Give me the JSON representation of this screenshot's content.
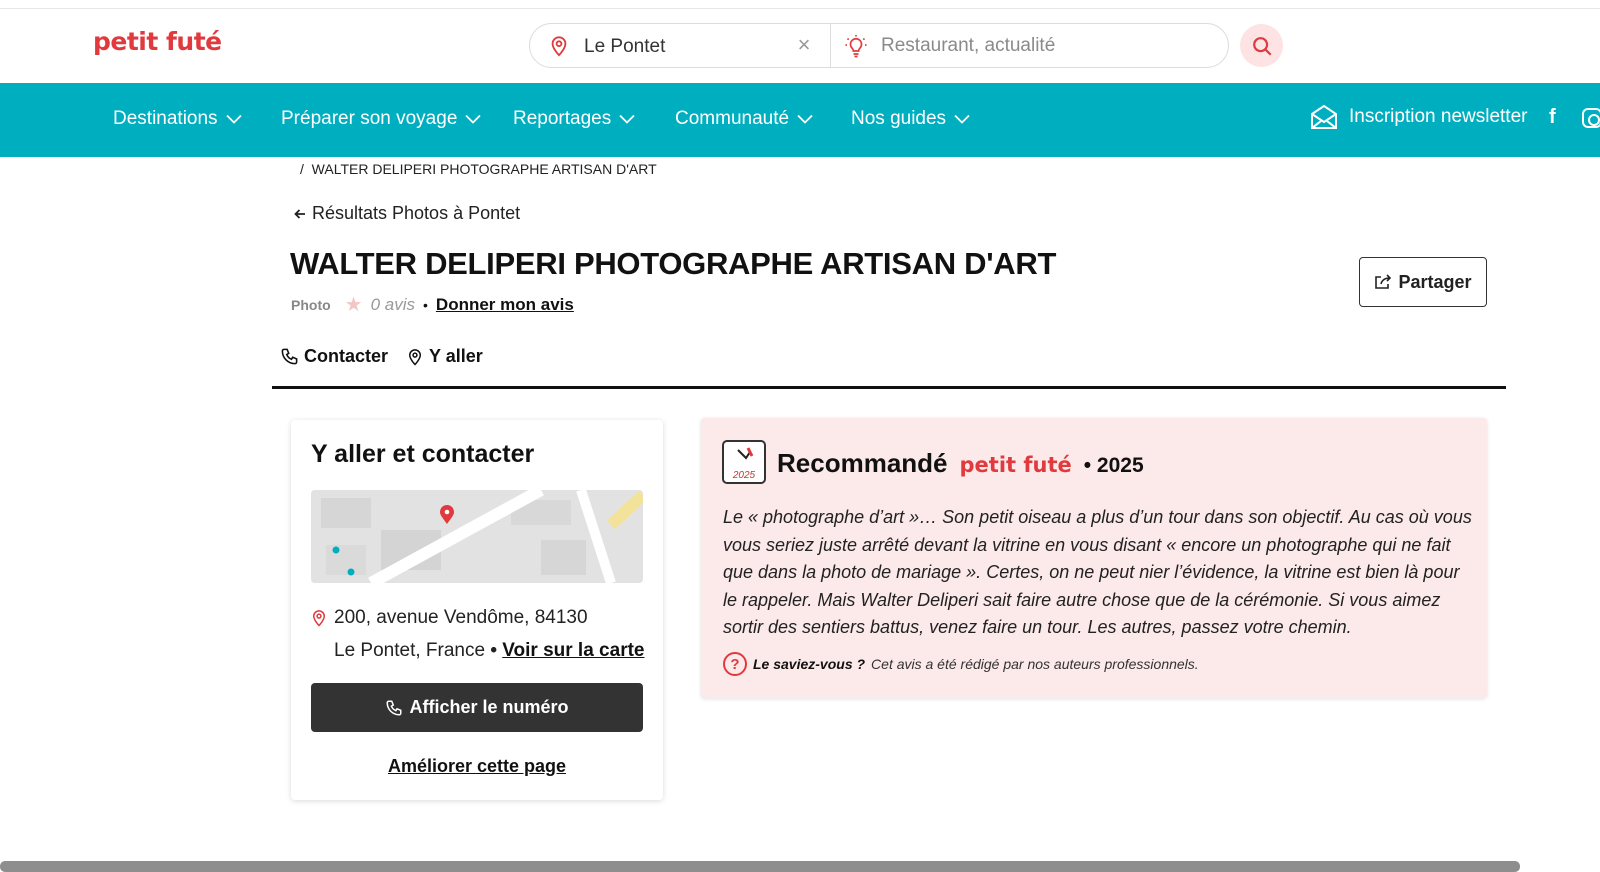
{
  "header": {
    "logo": "petit futé",
    "location_value": "Le Pontet",
    "clear_symbol": "×",
    "what_placeholder": "Restaurant, actualité"
  },
  "nav": {
    "items": [
      {
        "label": "Destinations"
      },
      {
        "label": "Préparer son voyage"
      },
      {
        "label": "Reportages"
      },
      {
        "label": "Communauté"
      },
      {
        "label": "Nos guides"
      }
    ],
    "newsletter": "Inscription newsletter",
    "facebook": "f"
  },
  "breadcrumb": {
    "separator": "/",
    "current": "WALTER DELIPERI PHOTOGRAPHE ARTISAN D'ART"
  },
  "back_link": "Résultats Photos à Pontet",
  "page": {
    "title": "WALTER DELIPERI PHOTOGRAPHE ARTISAN D'ART",
    "category": "Photo",
    "star": "★",
    "reviews": "0 avis",
    "bullet": "•",
    "give_review": "Donner mon avis",
    "share": "Partager"
  },
  "tabs": [
    {
      "label": "Contacter"
    },
    {
      "label": "Y aller"
    }
  ],
  "contact_card": {
    "heading": "Y aller et contacter",
    "address_line1": "200, avenue Vendôme, 84130",
    "address_line2": "Le Pontet, France",
    "bullet": "•",
    "map_link": "Voir sur la carte",
    "phone_button": "Afficher le numéro",
    "improve_link": "Améliorer cette page"
  },
  "recommendation": {
    "badge_year": "2025",
    "label": "Recommandé",
    "brand": "petit futé",
    "year": "• 2025",
    "text": "Le « photographe d’art »… Son petit oiseau a plus d’un tour dans son objectif. Au cas où vous vous seriez juste arrêté devant la vitrine en vous disant « encore un photographe qui ne fait que dans la photo de mariage ». Certes, on ne peut nier l’évidence, la vitrine est bien là pour le rappeler. Mais Walter Deliperi sait faire autre chose que de la cérémonie. Si vous aimez sortir des sentiers battus, venez faire un tour. Les autres, passez votre chemin.",
    "note_icon": "?",
    "note_label": "Le saviez-vous ?",
    "note_text": "Cet avis a été rédigé par nos auteurs professionnels."
  },
  "colors": {
    "brand_red": "#e03a3e",
    "nav_teal": "#00afbf",
    "reco_bg": "#fce9ea",
    "button_dark": "#333333"
  },
  "icons": [
    "location-pin-icon",
    "close-icon",
    "lightbulb-icon",
    "search-icon",
    "chevron-down-icon",
    "envelope-icon",
    "facebook-icon",
    "instagram-icon",
    "arrow-left-icon",
    "share-icon",
    "phone-icon",
    "award-badge-icon",
    "help-circle-icon"
  ]
}
